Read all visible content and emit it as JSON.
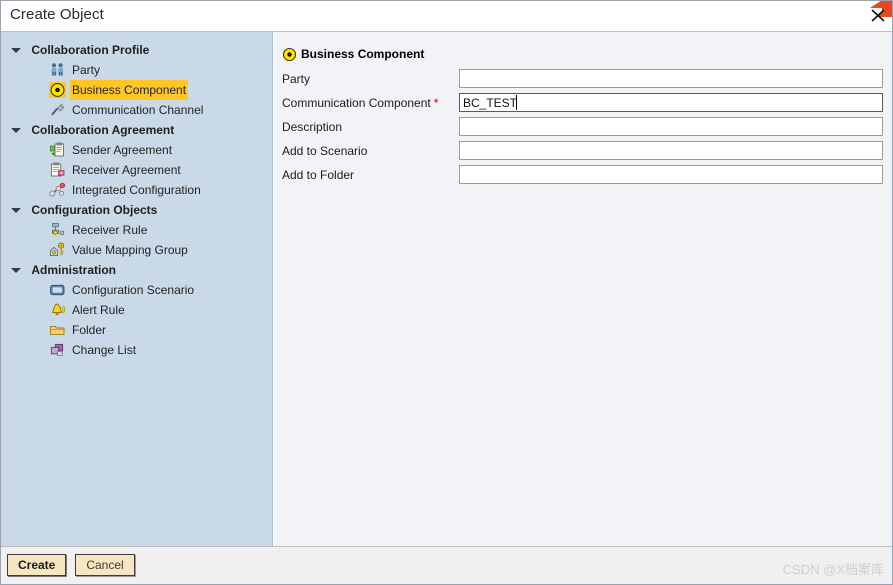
{
  "window": {
    "title": "Create Object",
    "close_icon": "close-x-icon",
    "brand_icon": "orange-swoosh-logo"
  },
  "sidebar": {
    "groups": [
      {
        "label": "Collaboration Profile",
        "items": [
          {
            "label": "Party",
            "icon": "party-people-icon",
            "selected": false
          },
          {
            "label": "Business Component",
            "icon": "business-component-radio-icon",
            "selected": true
          },
          {
            "label": "Communication Channel",
            "icon": "communication-plug-icon",
            "selected": false
          }
        ]
      },
      {
        "label": "Collaboration Agreement",
        "items": [
          {
            "label": "Sender Agreement",
            "icon": "sender-agreement-clipboard-icon",
            "selected": false
          },
          {
            "label": "Receiver Agreement",
            "icon": "receiver-agreement-clipboard-icon",
            "selected": false
          },
          {
            "label": "Integrated Configuration",
            "icon": "integrated-configuration-molecule-icon",
            "selected": false
          }
        ]
      },
      {
        "label": "Configuration Objects",
        "items": [
          {
            "label": "Receiver Rule",
            "icon": "receiver-rule-hierarchy-icon",
            "selected": false
          },
          {
            "label": "Value Mapping Group",
            "icon": "value-mapping-key-icon",
            "selected": false
          }
        ]
      },
      {
        "label": "Administration",
        "items": [
          {
            "label": "Configuration Scenario",
            "icon": "configuration-scenario-screen-icon",
            "selected": false
          },
          {
            "label": "Alert Rule",
            "icon": "alert-bell-icon",
            "selected": false
          },
          {
            "label": "Folder",
            "icon": "folder-icon",
            "selected": false
          },
          {
            "label": "Change List",
            "icon": "change-list-stack-icon",
            "selected": false
          }
        ]
      }
    ]
  },
  "panel": {
    "header": {
      "title": "Business Component",
      "icon": "business-component-radio-icon"
    },
    "fields": [
      {
        "label": "Party",
        "required": false,
        "value": "",
        "placeholder": "",
        "focused": false
      },
      {
        "label": "Communication Component",
        "required": true,
        "value": "BC_TEST",
        "placeholder": "",
        "focused": true
      },
      {
        "label": "Description",
        "required": false,
        "value": "",
        "placeholder": "",
        "focused": false
      },
      {
        "label": "Add to Scenario",
        "required": false,
        "value": "",
        "placeholder": "",
        "focused": false
      },
      {
        "label": "Add to Folder",
        "required": false,
        "value": "",
        "placeholder": "",
        "focused": false
      }
    ],
    "required_marker": "*"
  },
  "footer": {
    "create_label": "Create",
    "cancel_label": "Cancel",
    "watermark": "CSDN @X档案库"
  },
  "colors": {
    "sidebar_bg": "#c9d9e8",
    "panel_bg": "#f2f3f6",
    "selection": "#ffc726",
    "required": "#d40000",
    "button_bg": "#f6e7c2",
    "brand_orange": "#e8491d"
  }
}
